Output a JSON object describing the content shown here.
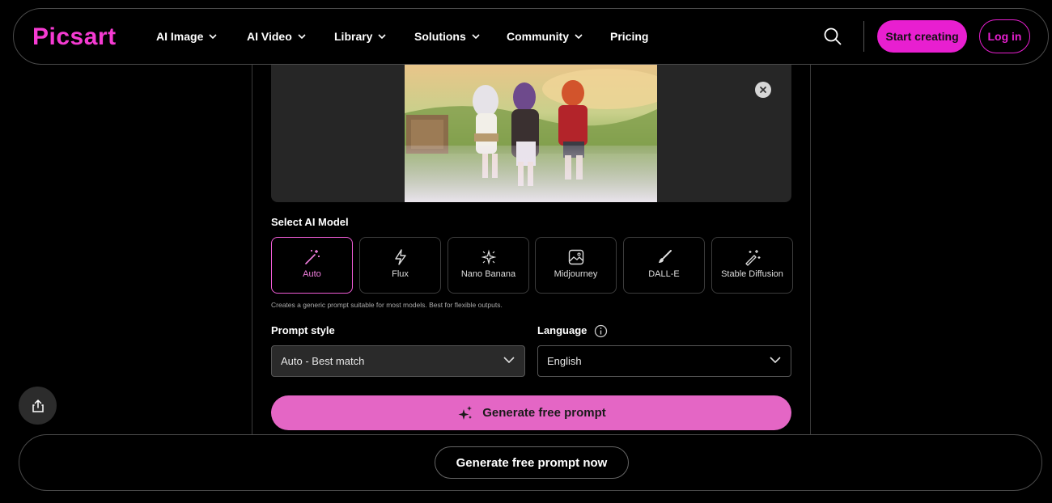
{
  "brand": {
    "logo": "Picsart",
    "accent": "#e81fd0"
  },
  "nav": {
    "items": [
      {
        "label": "AI Image",
        "dropdown": true
      },
      {
        "label": "AI Video",
        "dropdown": true
      },
      {
        "label": "Library",
        "dropdown": true
      },
      {
        "label": "Solutions",
        "dropdown": true
      },
      {
        "label": "Community",
        "dropdown": true
      },
      {
        "label": "Pricing",
        "dropdown": false
      }
    ],
    "search_icon": "search-icon",
    "start_label": "Start creating",
    "login_label": "Log in"
  },
  "upload": {
    "remove_icon": "close-icon"
  },
  "models": {
    "label": "Select AI Model",
    "options": [
      {
        "label": "Auto",
        "icon": "magic-wand-icon",
        "selected": true
      },
      {
        "label": "Flux",
        "icon": "lightning-icon",
        "selected": false
      },
      {
        "label": "Nano Banana",
        "icon": "sparkle-burst-icon",
        "selected": false
      },
      {
        "label": "Midjourney",
        "icon": "image-icon",
        "selected": false
      },
      {
        "label": "DALL-E",
        "icon": "brush-icon",
        "selected": false
      },
      {
        "label": "Stable Diffusion",
        "icon": "magic-wand-stars-icon",
        "selected": false
      }
    ],
    "hint": "Creates a generic prompt suitable for most models. Best for flexible outputs."
  },
  "prompt_style": {
    "label": "Prompt style",
    "value": "Auto - Best match"
  },
  "language": {
    "label": "Language",
    "value": "English"
  },
  "generate_label": "Generate free prompt",
  "bottom": {
    "generate_now_label": "Generate free prompt now"
  }
}
